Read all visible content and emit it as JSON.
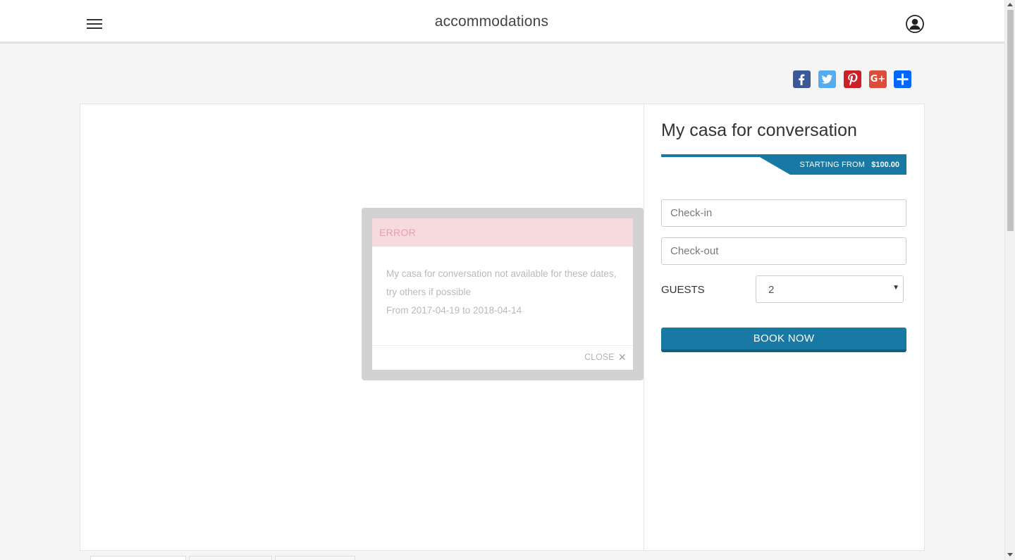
{
  "header": {
    "site_title": "accommodations",
    "menu_icon": "hamburger-menu-icon",
    "user_icon": "user-account-icon"
  },
  "share": {
    "buttons": [
      {
        "network": "facebook",
        "icon": "facebook-icon",
        "color": "#3b5998"
      },
      {
        "network": "twitter",
        "icon": "twitter-icon",
        "color": "#55acee"
      },
      {
        "network": "pinterest",
        "icon": "pinterest-icon",
        "color": "#cb2027"
      },
      {
        "network": "google-plus",
        "icon": "google-plus-icon",
        "color": "#dd4b39"
      },
      {
        "network": "share",
        "icon": "share-plus-icon",
        "color": "#0166ff"
      }
    ]
  },
  "listing": {
    "title": "My casa for conversation",
    "price_label": "STARTING FROM",
    "price_value": "$100.00",
    "accent_color": "#1979a5"
  },
  "booking": {
    "checkin_placeholder": "Check-in",
    "checkout_placeholder": "Check-out",
    "guests_label": "GUESTS",
    "guests_value": "2",
    "book_button": "BOOK NOW"
  },
  "modal": {
    "title": "ERROR",
    "message_line1": "My casa for conversation not available for these dates, try others if possible",
    "message_line2": "From 2017-04-19 to 2018-04-14",
    "close_label": "CLOSE",
    "header_color": "#f6dade"
  }
}
